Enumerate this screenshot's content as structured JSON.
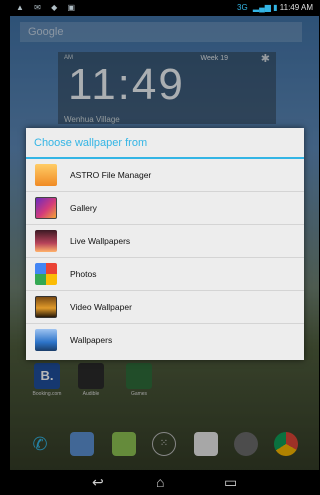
{
  "status_bar": {
    "network": "3G",
    "time": "11:49 AM"
  },
  "search_widget": {
    "label": "Google"
  },
  "clock_widget": {
    "am": "AM",
    "week": "Week 19",
    "time": "11:49",
    "location": "Wenhua Village"
  },
  "dialog": {
    "title": "Choose wallpaper from",
    "options": [
      {
        "label": "ASTRO File Manager",
        "icon": "astro-file-manager-icon"
      },
      {
        "label": "Gallery",
        "icon": "gallery-icon"
      },
      {
        "label": "Live Wallpapers",
        "icon": "live-wallpapers-icon"
      },
      {
        "label": "Photos",
        "icon": "photos-icon"
      },
      {
        "label": "Video Wallpaper",
        "icon": "video-wallpaper-icon"
      },
      {
        "label": "Wallpapers",
        "icon": "wallpapers-icon"
      }
    ]
  },
  "home_apps": [
    {
      "label": "Booking.com",
      "icon_text": "B."
    },
    {
      "label": "Audible",
      "icon_text": ""
    },
    {
      "label": "Games",
      "icon_text": ""
    }
  ],
  "dock": [
    "phone-icon",
    "contacts-icon",
    "messaging-icon",
    "app-drawer-icon",
    "play-store-icon",
    "camera-icon",
    "chrome-icon"
  ],
  "nav": {
    "back": "back-icon",
    "home": "home-icon",
    "recents": "recents-icon"
  }
}
